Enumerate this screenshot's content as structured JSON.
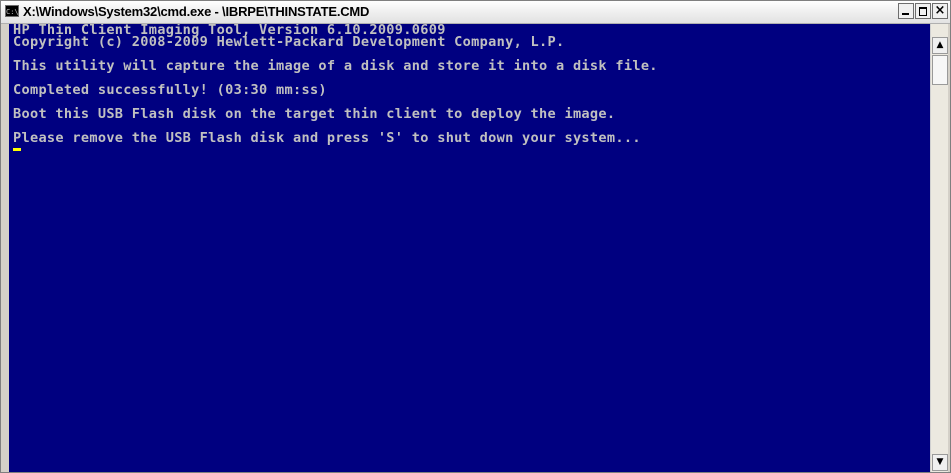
{
  "window": {
    "title": "X:\\Windows\\System32\\cmd.exe - \\IBRPE\\THINSTATE.CMD",
    "icon": "cmd-icon",
    "icon_label": "C:\\",
    "buttons": {
      "minimize": "minimize-icon",
      "maximize": "maximize-icon",
      "close": "×"
    }
  },
  "console": {
    "background": "#000080",
    "text_color": "#c0c0c0",
    "cursor_color": "#ffff00",
    "lines": [
      "HP Thin Client Imaging Tool, Version 6.10.2009.0609",
      "Copyright (c) 2008-2009 Hewlett-Packard Development Company, L.P.",
      "",
      "This utility will capture the image of a disk and store it into a disk file.",
      "",
      "Completed successfully! (03:30 mm:ss)",
      "",
      "Boot this USB Flash disk on the target thin client to deploy the image.",
      "",
      "Please remove the USB Flash disk and press 'S' to shut down your system..."
    ]
  },
  "scrollbar": {
    "up": "▲",
    "down": "▼"
  }
}
